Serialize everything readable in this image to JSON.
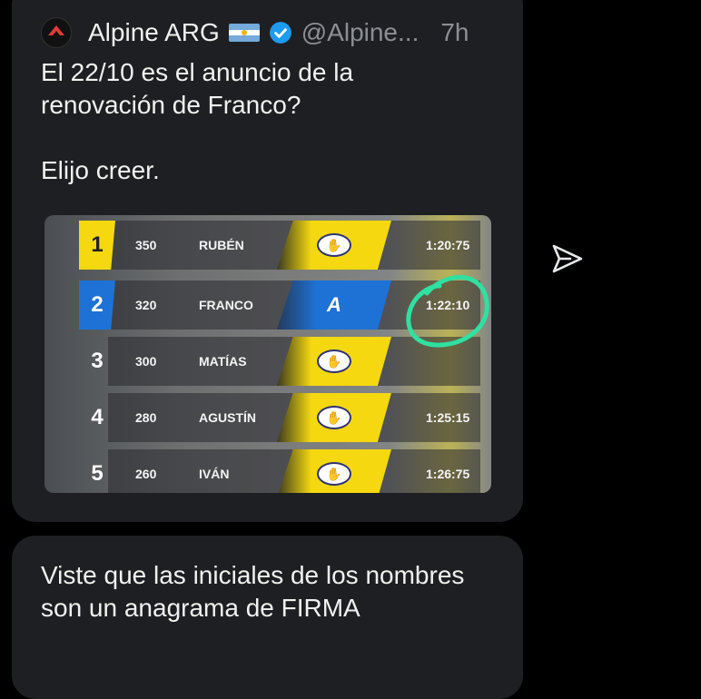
{
  "tweet": {
    "author_name": "Alpine ARG",
    "handle": "@Alpine...",
    "time": "7h",
    "text": "El 22/10 es el anuncio de la\nrenovación de Franco?\n\nElijo creer.",
    "avatar_text": "ALPINE"
  },
  "leaderboard": {
    "rows": [
      {
        "position": "1",
        "points": "350",
        "driver": "RUBÉN",
        "team": "mercado-libre",
        "time": "1:20:75"
      },
      {
        "position": "2",
        "points": "320",
        "driver": "FRANCO",
        "team": "alpine",
        "time": "1:22:10"
      },
      {
        "position": "3",
        "points": "300",
        "driver": "MATÍAS",
        "team": "mercado-libre",
        "time": ""
      },
      {
        "position": "4",
        "points": "280",
        "driver": "AGUSTÍN",
        "team": "mercado-libre",
        "time": "1:25:15"
      },
      {
        "position": "5",
        "points": "260",
        "driver": "IVÁN",
        "team": "mercado-libre",
        "time": "1:26:75"
      }
    ]
  },
  "reply": {
    "text": "Viste que las iniciales de los nombres son un anagrama de FIRMA"
  },
  "icons": [
    "alpine-logo-icon",
    "argentina-flag-icon",
    "verified-badge-icon",
    "share-icon",
    "mercado-libre-logo-icon",
    "alpine-team-logo-icon"
  ],
  "colors": {
    "verified": "#1d9bf0",
    "circle_annotation": "#2fe0a0",
    "team_yellow": "#f5d80f",
    "team_blue": "#1e72d6"
  }
}
